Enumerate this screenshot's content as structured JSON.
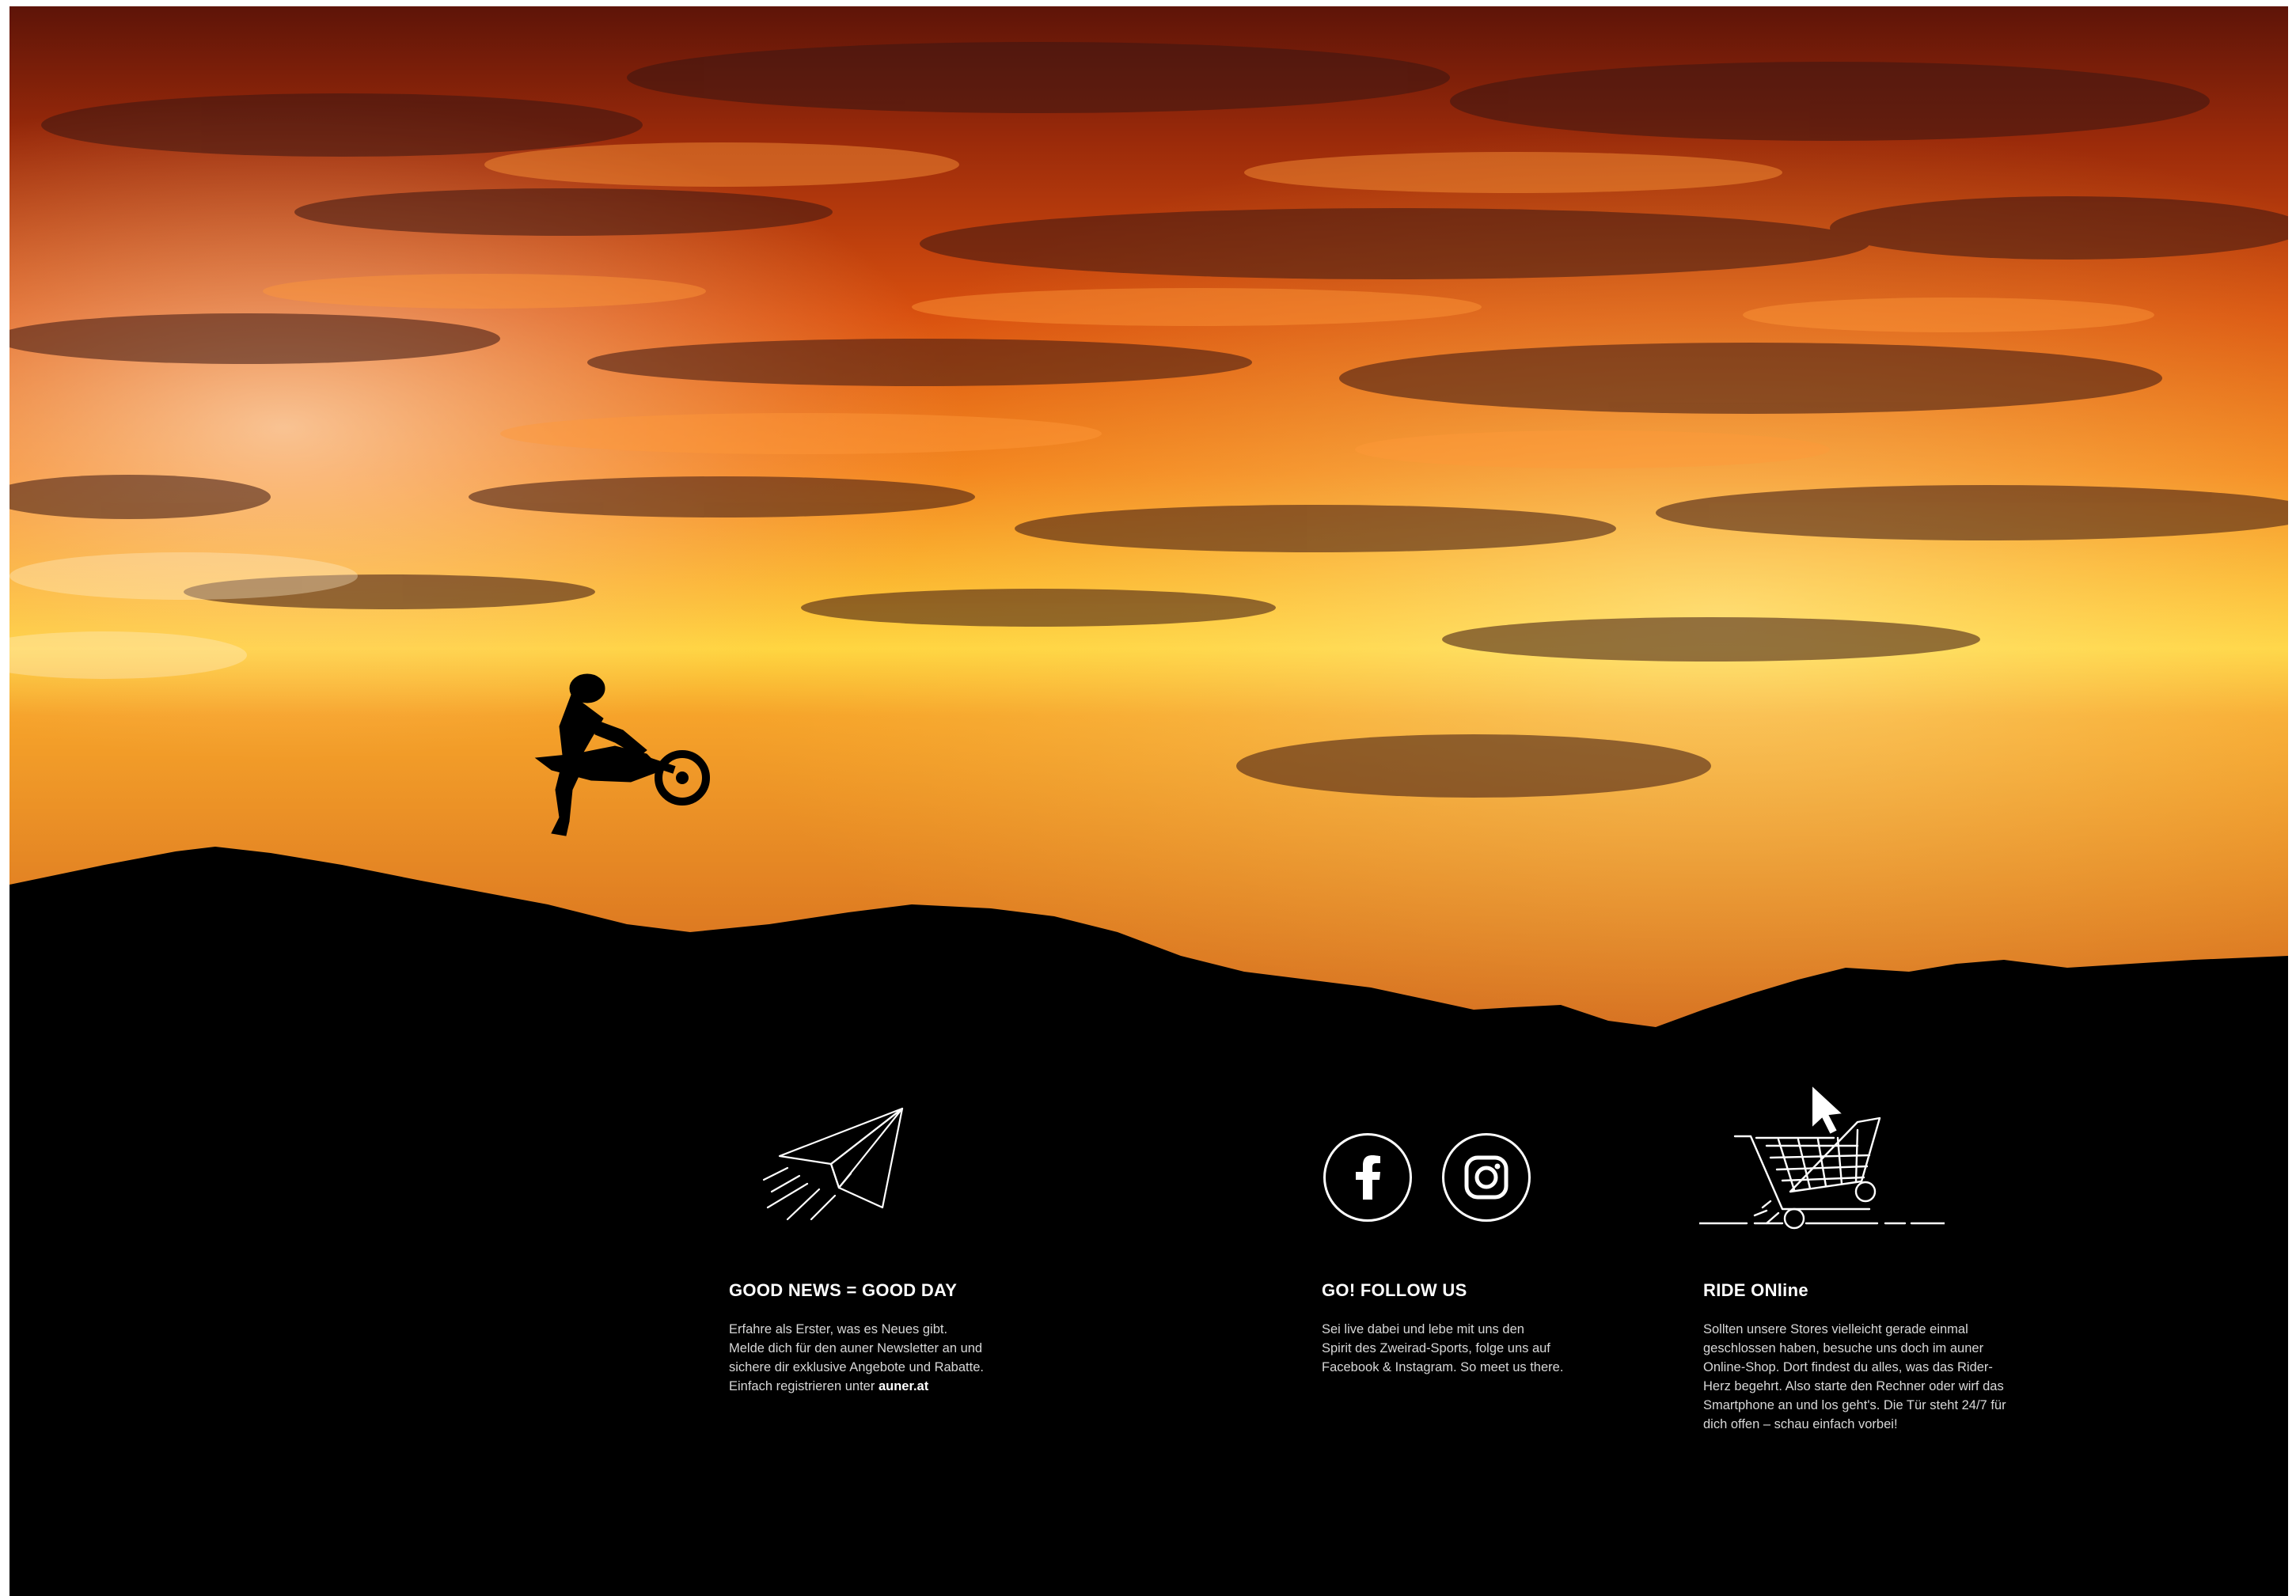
{
  "newsletter": {
    "icon": "paper-plane-icon",
    "title": "GOOD NEWS = GOOD DAY",
    "lines": [
      "Erfahre als Erster, was es Neues gibt.",
      "Melde dich für den auner Newsletter an und",
      "sichere dir exklusive Angebote und Rabatte."
    ],
    "last_line_prefix": "Einfach registrieren unter",
    "link": "auner.at"
  },
  "social": {
    "title": "GO! FOLLOW US",
    "lines": [
      "Sei live dabei und lebe mit uns den",
      "Spirit des Zweirad-Sports, folge uns auf",
      "Facebook & Instagram. So meet us there."
    ],
    "icons": [
      "facebook-icon",
      "instagram-icon"
    ]
  },
  "shop": {
    "icon": "shopping-cart-cursor-icon",
    "title": "RIDE ONline",
    "lines": [
      "Sollten unsere Stores vielleicht gerade einmal",
      "geschlossen haben, besuche uns doch im auner",
      "Online-Shop. Dort findest du alles, was das Rider-",
      "Herz begehrt. Also starte den Rechner oder wirf das",
      "Smartphone an und los geht's. Die Tür steht 24/7 für",
      "dich offen – schau einfach vorbei!"
    ]
  },
  "colors": {
    "sky_top": "#7a1c08",
    "sky_mid": "#f06a12",
    "sky_glow": "#ffd23a",
    "silhouette": "#000000",
    "text_body": "#d7d7d7"
  }
}
